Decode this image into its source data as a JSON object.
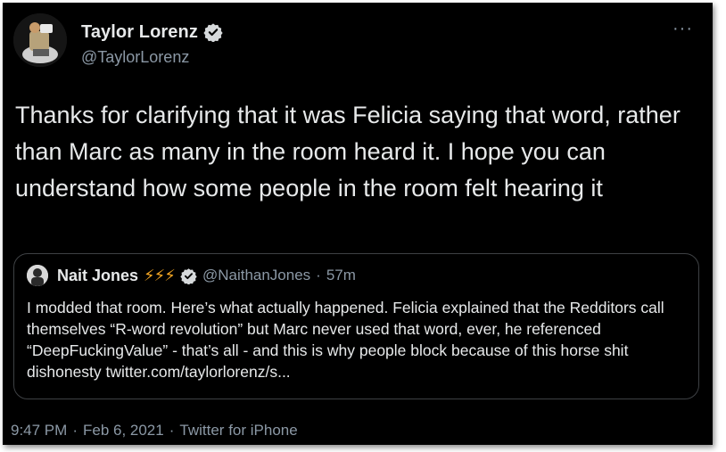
{
  "author": {
    "display_name": "Taylor Lorenz",
    "handle": "@TaylorLorenz",
    "verified_icon": "verified-badge-icon",
    "more_label": "···"
  },
  "tweet": {
    "text": "Thanks for clarifying that it was Felicia saying that word, rather than Marc as many in the room heard it. I hope you can understand how some people in the room felt hearing it"
  },
  "quoted_tweet": {
    "display_name": "Nait Jones",
    "emoji": "⚡⚡⚡",
    "handle": "@NaithanJones",
    "separator": "·",
    "time": "57m",
    "text": "I modded that room. Here’s what actually happened. Felicia explained that the Redditors call themselves “R-word revolution” but Marc never used that word, ever, he referenced “DeepFuckingValue” - that’s all - and this is why people block because of this horse shit dishonesty twitter.com/taylorlorenz/s..."
  },
  "meta": {
    "time": "9:47 PM",
    "separator": "·",
    "date": "Feb 6, 2021",
    "separator2": "·",
    "source": "Twitter for iPhone"
  },
  "colors": {
    "background": "#000000",
    "text": "#e7e9ea",
    "secondary_text": "#8b98a5",
    "border": "#3e4144",
    "verified": "#d6d9db",
    "lightning": "#f5a623"
  }
}
